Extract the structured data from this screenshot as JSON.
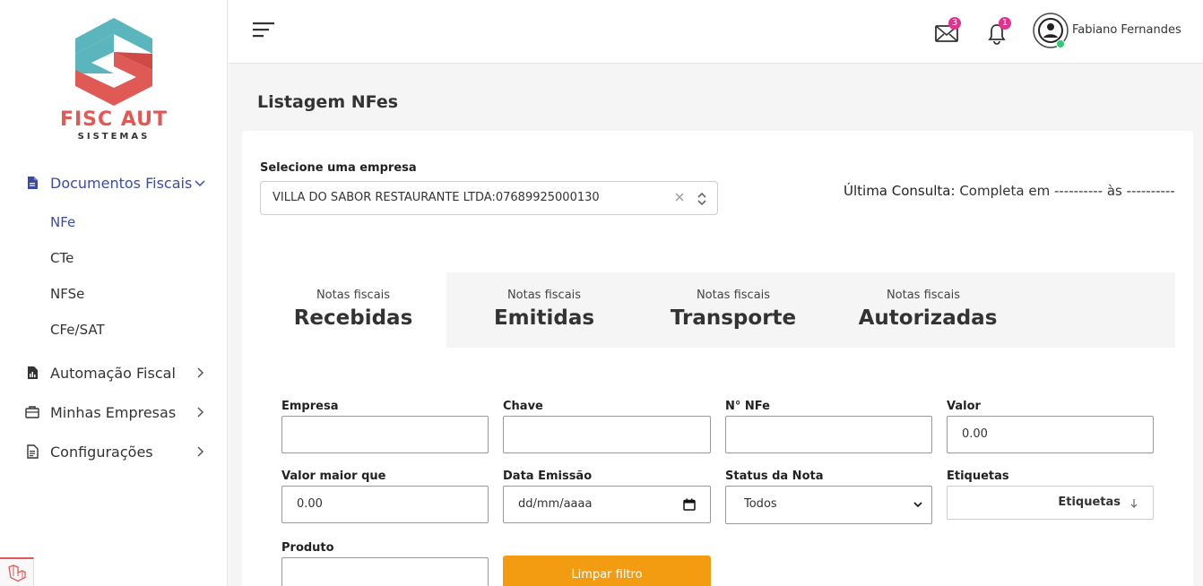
{
  "brand": {
    "name": "FISC AUT",
    "subtitle": "SISTEMAS"
  },
  "sidebar": {
    "groups": [
      {
        "label": "Documentos Fiscais",
        "icon": "document-icon",
        "expanded": true,
        "items": [
          "NFe",
          "CTe",
          "NFSe",
          "CFe/SAT"
        ],
        "active_item": "NFe"
      },
      {
        "label": "Automação Fiscal",
        "icon": "file-chart-icon"
      },
      {
        "label": "Minhas Empresas",
        "icon": "briefcase-icon"
      },
      {
        "label": "Configurações",
        "icon": "file-settings-icon"
      }
    ]
  },
  "topbar": {
    "mail_count": "3",
    "notification_count": "1",
    "user_name": "Fabiano Fernandes",
    "status_color": "#2ecc71"
  },
  "page": {
    "title": "Listagem NFes",
    "company_select_label": "Selecione uma empresa",
    "company_selected": "VILLA DO SABOR RESTAURANTE LTDA:07689925000130",
    "last_query_label": "Última Consulta:",
    "last_query_value": "Completa em ---------- às ----------"
  },
  "tabs": [
    {
      "small": "Notas fiscais",
      "big": "Recebidas",
      "active": true
    },
    {
      "small": "Notas fiscais",
      "big": "Emitidas"
    },
    {
      "small": "Notas fiscais",
      "big": "Transporte"
    },
    {
      "small": "Notas fiscais",
      "big": "Autorizadas"
    }
  ],
  "filters": {
    "empresa_label": "Empresa",
    "empresa_value": "",
    "chave_label": "Chave",
    "chave_value": "",
    "nfe_label": "N° NFe",
    "nfe_value": "",
    "valor_label": "Valor",
    "valor_value": "0.00",
    "valor_maior_label": "Valor maior que",
    "valor_maior_value": "0.00",
    "data_label": "Data Emissão",
    "data_placeholder": "dd/mm/aaaa",
    "status_label": "Status da Nota",
    "status_value": "Todos",
    "etiquetas_label": "Etiquetas",
    "etiquetas_button": "Etiquetas",
    "produto_label": "Produto",
    "produto_value": "",
    "clear_button": "Limpar filtro"
  },
  "colors": {
    "accent": "#3a4ba8",
    "brand_red": "#e05a55",
    "brand_teal": "#5bb5bd",
    "clear_button": "#f39c12",
    "badge": "#e2338c"
  }
}
